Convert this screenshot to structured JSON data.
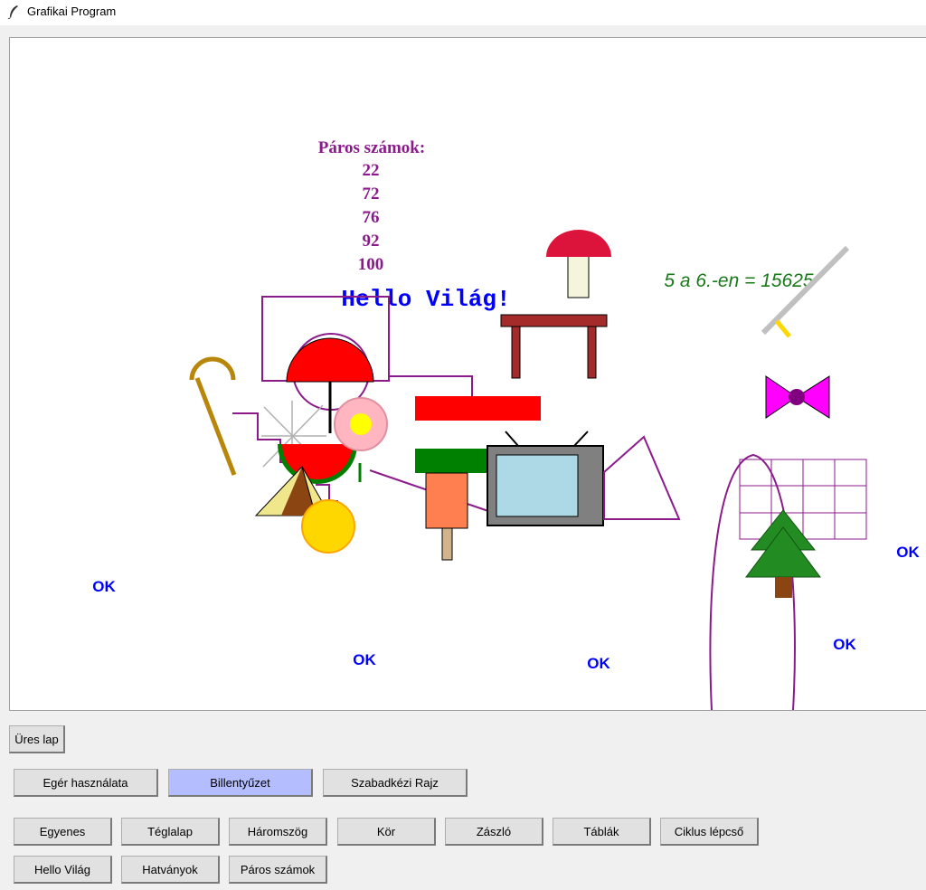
{
  "window": {
    "title": "Grafikai Program"
  },
  "canvas": {
    "paros_title": "Páros számok:",
    "paros_numbers": [
      "22",
      "72",
      "76",
      "92",
      "100"
    ],
    "hello": "Hello Világ!",
    "power": "5 a 6.-en = 15625",
    "ok_label": "OK"
  },
  "buttons": {
    "ures_lap": "Üres lap",
    "eger": "Egér használata",
    "billentyuzet": "Billentyűzet",
    "szabadkezi": "Szabadkézi Rajz",
    "egyenes": "Egyenes",
    "teglalap": "Téglalap",
    "haromszog": "Háromszög",
    "kor": "Kör",
    "zaszlo": "Zászló",
    "tablak": "Táblák",
    "ciklus": "Ciklus lépcső",
    "hello": "Hello Világ",
    "hatvanyok": "Hatványok",
    "paros": "Páros számok"
  },
  "colors": {
    "purple": "#8b1a8b",
    "blue_text": "#0000ff",
    "green_text": "#1a7a1a",
    "active_button": "#b4befe"
  },
  "icons": {
    "app_icon": "feather-icon"
  }
}
